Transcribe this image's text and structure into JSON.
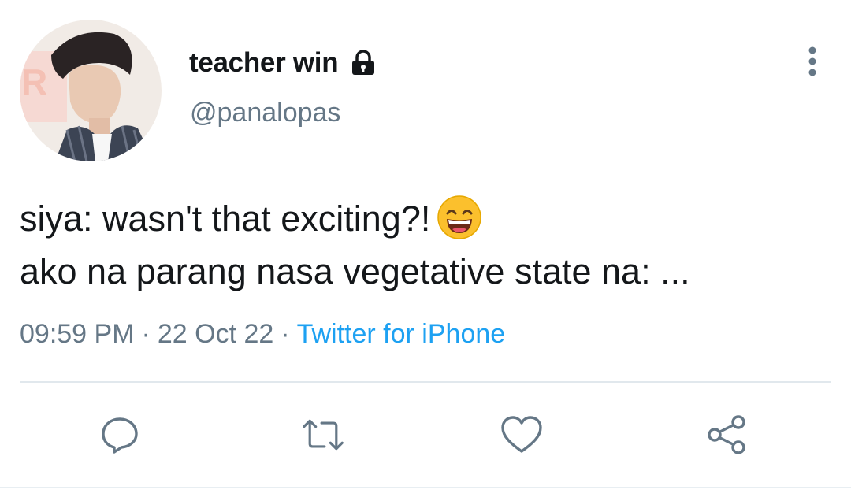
{
  "user": {
    "display_name": "teacher win",
    "handle": "@panalopas",
    "protected_icon": "lock-icon",
    "avatar_icon": "avatar-photo"
  },
  "tweet": {
    "line1": "siya: wasn't that exciting?!",
    "emoji": "grinning-face-with-smiling-eyes-emoji",
    "line2": "ako na parang nasa vegetative state na: ..."
  },
  "meta": {
    "time": "09:59 PM",
    "separator": "·",
    "date": "22 Oct 22",
    "source": "Twitter for iPhone"
  },
  "actions": {
    "reply_icon": "reply-icon",
    "retweet_icon": "retweet-icon",
    "like_icon": "heart-icon",
    "share_icon": "share-icon",
    "more_icon": "more-vertical-icon"
  },
  "colors": {
    "text": "#14171a",
    "secondary": "#657786",
    "link": "#1da1f2",
    "divider": "#e1e8ed"
  }
}
